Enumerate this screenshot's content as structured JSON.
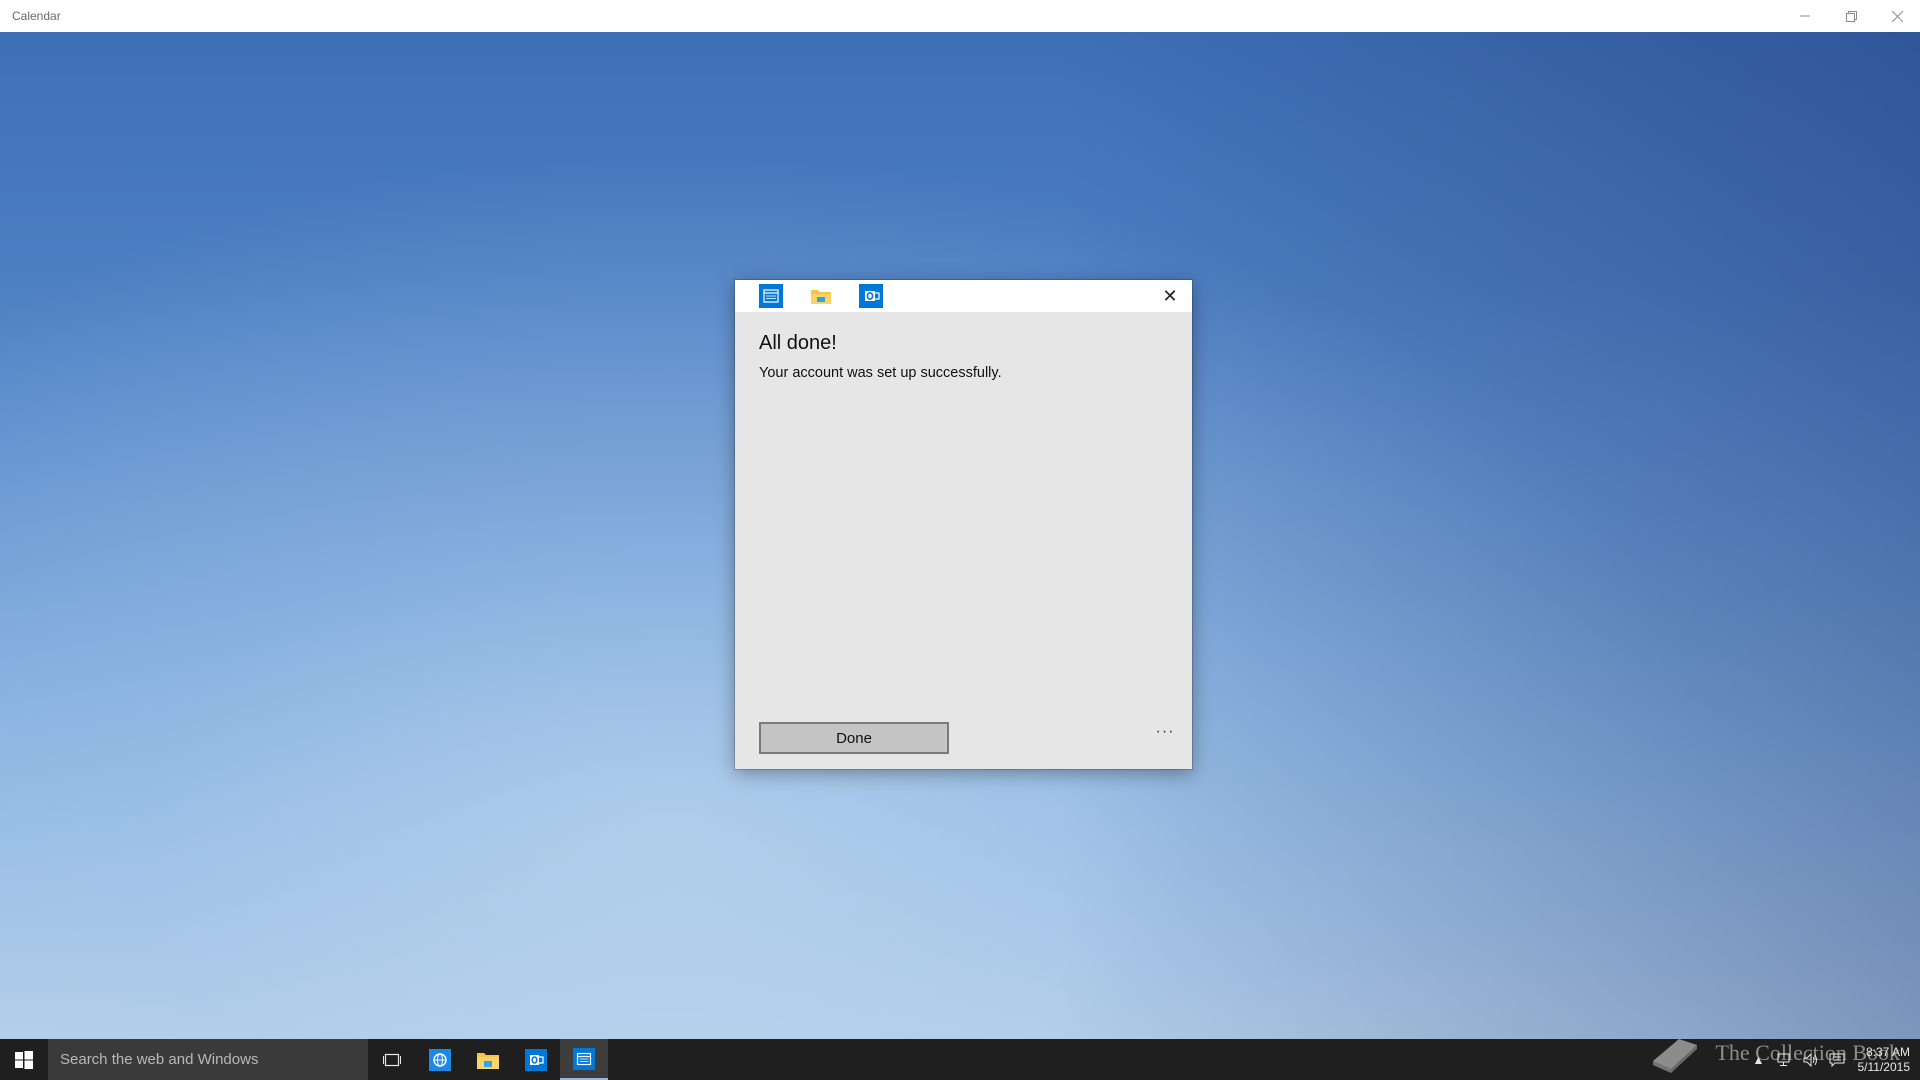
{
  "window": {
    "title": "Calendar",
    "controls": {
      "minimize": "—",
      "restore": "❐",
      "close": "✕"
    }
  },
  "dialog": {
    "header_icons": [
      "calendar-app-icon",
      "file-explorer-icon",
      "outlook-icon"
    ],
    "close_glyph": "✕",
    "title": "All done!",
    "message": "Your account was set up successfully.",
    "done_label": "Done",
    "more_label": "···"
  },
  "taskbar": {
    "search_placeholder": "Search the web and Windows",
    "pinned": [
      "task-view-icon",
      "internet-explorer-icon",
      "file-explorer-icon",
      "outlook-icon",
      "calendar-icon"
    ],
    "active_item": "calendar-icon",
    "time": "8:37 AM",
    "date": "5/11/2015"
  },
  "watermark": {
    "text": "The Collection Book"
  },
  "colors": {
    "accent": "#0078d7",
    "dialog_bg": "#e6e6e6",
    "taskbar_bg": "#1f1f1f",
    "folder_yellow": "#f4c542"
  }
}
